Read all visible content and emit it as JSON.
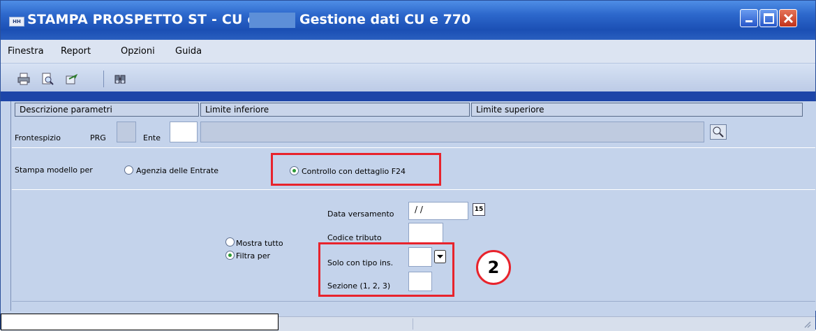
{
  "window": {
    "title_prefix": "STAMPA PROSPETTO ST - CU e 770",
    "title_suffix": "Gestione dati CU e 770",
    "icon_text": "HH",
    "title_bar_color": "#2a5fbf"
  },
  "menu": [
    "Finestra",
    "Report",
    "Opzioni",
    "Guida"
  ],
  "toolbar": {
    "icons": [
      "print-icon",
      "print-preview-icon",
      "export-icon",
      "binoculars-icon"
    ]
  },
  "grid": {
    "headers": [
      "Descrizione parametri",
      "Limite inferiore",
      "Limite superiore"
    ]
  },
  "frontespizio": {
    "label": "Frontespizio",
    "prg_label": "PRG",
    "ente_label": "Ente"
  },
  "stampa": {
    "label": "Stampa modello per",
    "options": [
      {
        "label": "Agenzia delle Entrate",
        "selected": false
      },
      {
        "label": "Controllo con dettaglio F24",
        "selected": true
      }
    ]
  },
  "filtro": {
    "options": [
      {
        "label": "Mostra tutto",
        "selected": false
      },
      {
        "label": "Filtra per",
        "selected": true
      }
    ],
    "data_versamento_label": "Data versamento",
    "data_versamento_value": "/ /",
    "calendar_day": "15",
    "codice_tributo_label": "Codice tributo",
    "solo_tipo_label": "Solo con tipo ins.",
    "sezione_label": "Sezione (1, 2, 3)"
  },
  "callout": "2",
  "colors": {
    "highlight": "#e8232c",
    "background": "#c4d3eb"
  }
}
